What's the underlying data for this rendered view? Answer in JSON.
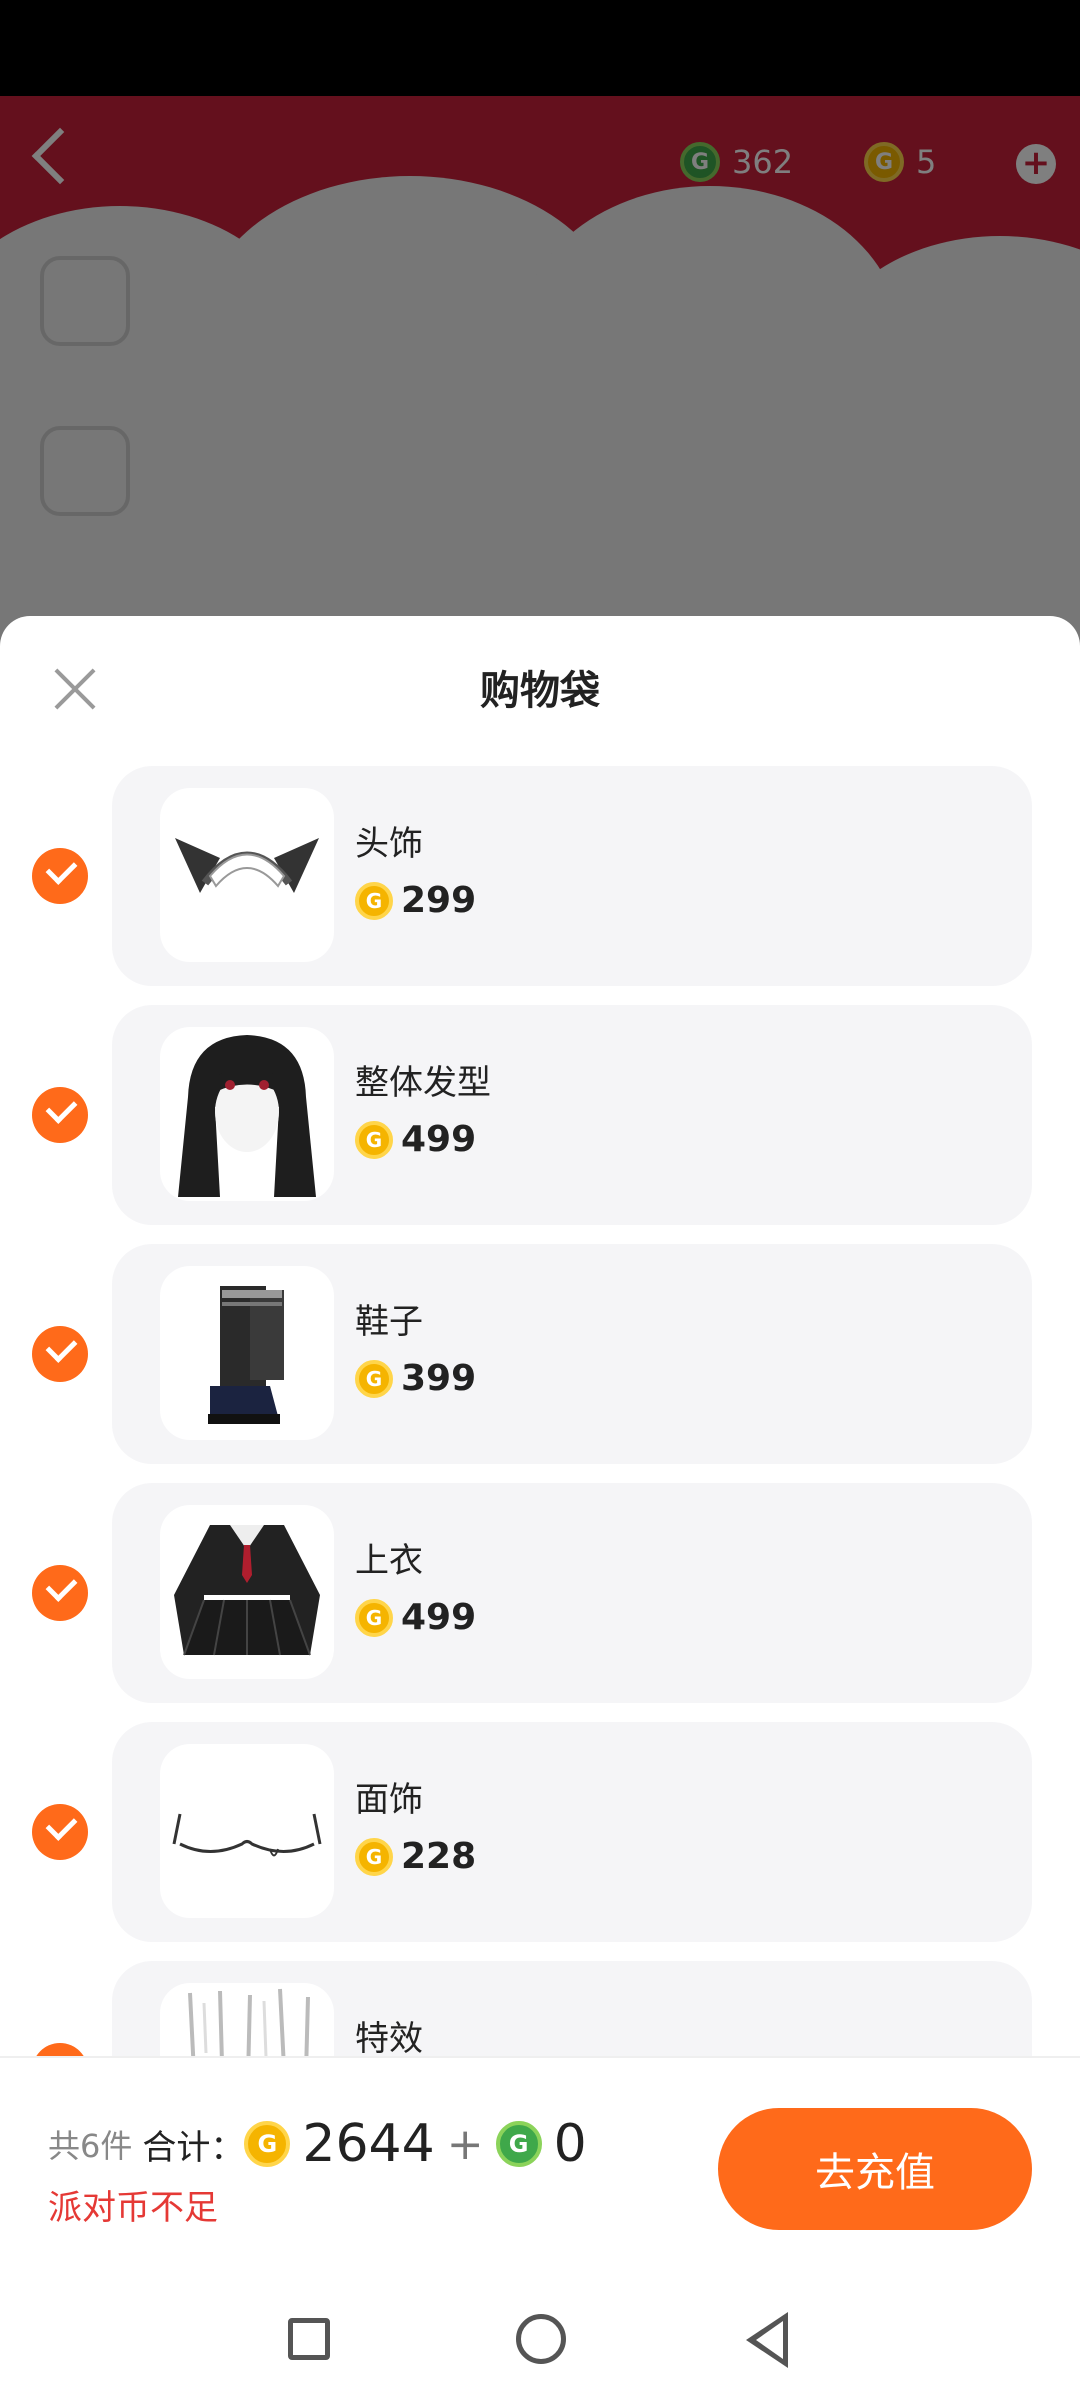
{
  "header": {
    "green_balance": "362",
    "gold_balance": "5"
  },
  "sheet": {
    "title": "购物袋"
  },
  "items": [
    {
      "name": "头饰",
      "price": "299",
      "checked": true
    },
    {
      "name": "整体发型",
      "price": "499",
      "checked": true
    },
    {
      "name": "鞋子",
      "price": "399",
      "checked": true
    },
    {
      "name": "上衣",
      "price": "499",
      "checked": true
    },
    {
      "name": "面饰",
      "price": "228",
      "checked": true
    },
    {
      "name": "特效",
      "price": "",
      "checked": true
    }
  ],
  "footer": {
    "count_text": "共6件",
    "total_label": "合计：",
    "gold_total": "2644",
    "plus": "+",
    "green_total": "0",
    "warning": "派对币不足",
    "recharge_label": "去充值"
  },
  "colors": {
    "accent": "#ff6a1a",
    "warning": "#e53935",
    "card_bg": "#f5f5f7"
  }
}
